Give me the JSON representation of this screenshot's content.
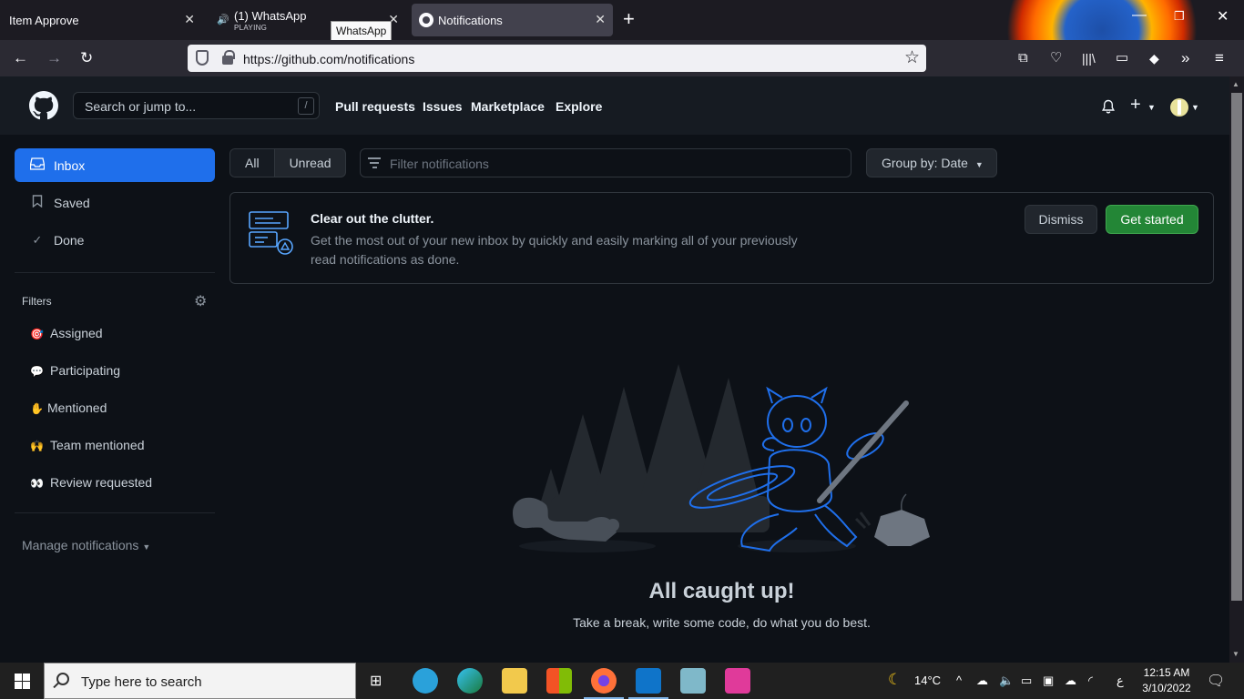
{
  "browser": {
    "tabs": [
      {
        "title": "Item Approve"
      },
      {
        "title": "(1) WhatsApp",
        "subtitle": "PLAYING"
      },
      {
        "title": "Notifications"
      }
    ],
    "tooltip": "WhatsApp",
    "url": "https://github.com/notifications"
  },
  "header": {
    "search_placeholder": "Search or jump to...",
    "search_key": "/",
    "nav": [
      "Pull requests",
      "Issues",
      "Marketplace",
      "Explore"
    ]
  },
  "sidebar": {
    "items": [
      {
        "label": "Inbox",
        "icon": "inbox-icon",
        "active": true
      },
      {
        "label": "Saved",
        "icon": "bookmark-icon"
      },
      {
        "label": "Done",
        "icon": "check-icon"
      }
    ],
    "filters_heading": "Filters",
    "filters": [
      {
        "label": "Assigned",
        "icon": "target-emoji"
      },
      {
        "label": "Participating",
        "icon": "speech-bubble-emoji"
      },
      {
        "label": "Mentioned",
        "icon": "raised-hand-emoji"
      },
      {
        "label": "Team mentioned",
        "icon": "raising-hands-emoji"
      },
      {
        "label": "Review requested",
        "icon": "eyes-emoji"
      }
    ],
    "manage": "Manage notifications"
  },
  "toolbar": {
    "segment_all": "All",
    "segment_unread": "Unread",
    "filter_placeholder": "Filter notifications",
    "group_by": "Group by: Date"
  },
  "banner": {
    "title": "Clear out the clutter.",
    "description": "Get the most out of your new inbox by quickly and easily marking all of your previously read notifications as done.",
    "dismiss": "Dismiss",
    "get_started": "Get started"
  },
  "empty_state": {
    "title": "All caught up!",
    "subtitle": "Take a break, write some code, do what you do best."
  },
  "taskbar": {
    "search_placeholder": "Type here to search",
    "weather": "14°C",
    "lang": "ع",
    "time": "12:15 AM",
    "date": "3/10/2022"
  },
  "colors": {
    "accent": "#1f6feb",
    "primary_button": "#238636",
    "page_bg": "#0d1117",
    "header_bg": "#161b22"
  }
}
